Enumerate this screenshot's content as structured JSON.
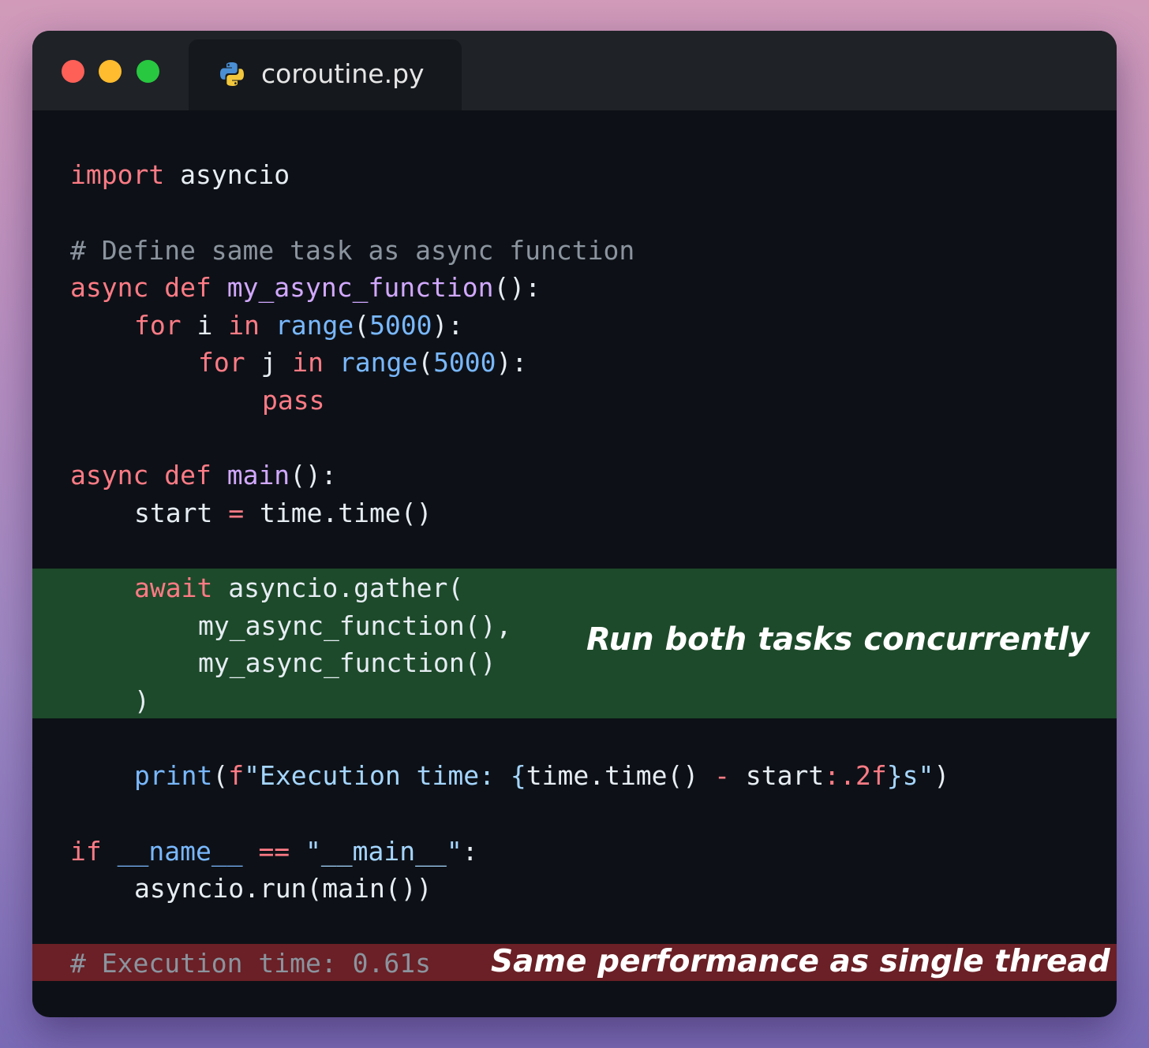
{
  "window": {
    "tab_title": "coroutine.py",
    "tab_icon": "python-icon",
    "controls": [
      "close",
      "minimize",
      "maximize"
    ],
    "colors": {
      "close": "#fe5f57",
      "minimize": "#febc2e",
      "maximize": "#28c840",
      "editor_bg": "#0d1117",
      "highlight_green": "#1d4a2a",
      "highlight_red": "#6a2026"
    }
  },
  "code": {
    "l1": {
      "kw": "import",
      "rest": " asyncio"
    },
    "l2": {
      "comment": "# Define same task as async function"
    },
    "l3": {
      "kw1": "async",
      "kw2": "def",
      "name": "my_async_function",
      "rest": "():"
    },
    "l4": {
      "kw1": "for",
      "var": " i ",
      "kw2": "in",
      "bi": "range",
      "open": "(",
      "num": "5000",
      "close": "):"
    },
    "l5": {
      "kw1": "for",
      "var": " j ",
      "kw2": "in",
      "bi": "range",
      "open": "(",
      "num": "5000",
      "close": "):"
    },
    "l6": {
      "kw": "pass"
    },
    "l7": {
      "kw1": "async",
      "kw2": "def",
      "name": "main",
      "rest": "():"
    },
    "l8": {
      "lhs": "start ",
      "op": "=",
      "rhs": " time.time()"
    },
    "l9": {
      "kw": "await",
      "rest": " asyncio.gather("
    },
    "l10": {
      "text": "my_async_function(),"
    },
    "l11": {
      "text": "my_async_function()"
    },
    "l12": {
      "text": ")"
    },
    "l13": {
      "fn": "print",
      "open": "(",
      "prefix": "f",
      "str1": "\"Execution time: ",
      "brace_open": "{",
      "expr1": "time.time() ",
      "op": "-",
      "expr2": " start",
      "fmt": ":.2f",
      "brace_close": "}",
      "str2": "s\"",
      "close": ")"
    },
    "l14": {
      "kw": "if",
      "name": " __name__ ",
      "op": "==",
      "str": " \"__main__\"",
      "rest": ":"
    },
    "l15": {
      "text": "asyncio.run(main())"
    },
    "l16": {
      "comment": "# Execution time: 0.61s"
    }
  },
  "annotations": {
    "concurrent": "Run both tasks concurrently",
    "performance": "Same performance as single thread"
  }
}
